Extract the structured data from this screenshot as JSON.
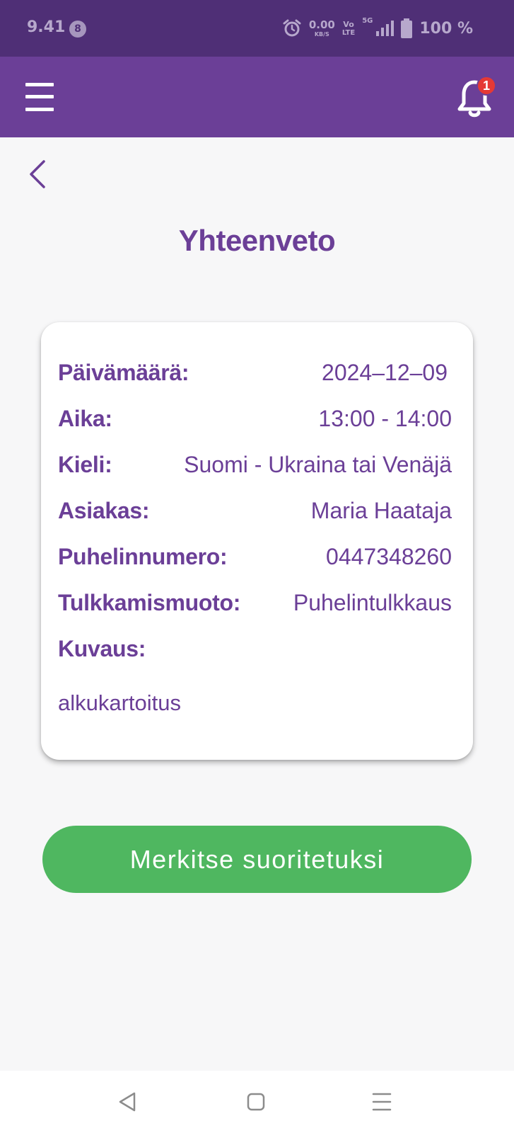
{
  "status_bar": {
    "time": "9.41",
    "notification_count": "8",
    "speed_value": "0.00",
    "speed_unit": "KB/S",
    "volte_top": "Vo",
    "volte_bottom": "LTE",
    "network": "5G",
    "battery": "100 %"
  },
  "app_bar": {
    "notification_badge": "1"
  },
  "page": {
    "title": "Yhteenveto"
  },
  "summary": {
    "rows": [
      {
        "label": "Päivämäärä:",
        "value": "2024–12–09"
      },
      {
        "label": "Aika:",
        "value": "13:00 - 14:00"
      },
      {
        "label": "Kieli:",
        "value": "Suomi - Ukraina tai Venäjä"
      },
      {
        "label": "Asiakas:",
        "value": "Maria Haataja"
      },
      {
        "label": "Puhelinnumero:",
        "value": "0447348260"
      },
      {
        "label": "Tulkkamismuoto:",
        "value": "Puhelintulkkaus"
      },
      {
        "label": "Kuvaus:",
        "value": ""
      }
    ],
    "description": "alkukartoitus"
  },
  "actions": {
    "complete_label": "Merkitse suoritetuksi"
  },
  "colors": {
    "primary": "#6b3f97",
    "status_bar": "#4f2f76",
    "success": "#4fb760",
    "badge": "#e53935"
  },
  "icons": {
    "menu": "hamburger-menu-icon",
    "notifications": "bell-icon",
    "back": "chevron-left-icon",
    "nav_back": "triangle-back-icon",
    "nav_home": "square-home-icon",
    "nav_recents": "menu-lines-icon"
  }
}
